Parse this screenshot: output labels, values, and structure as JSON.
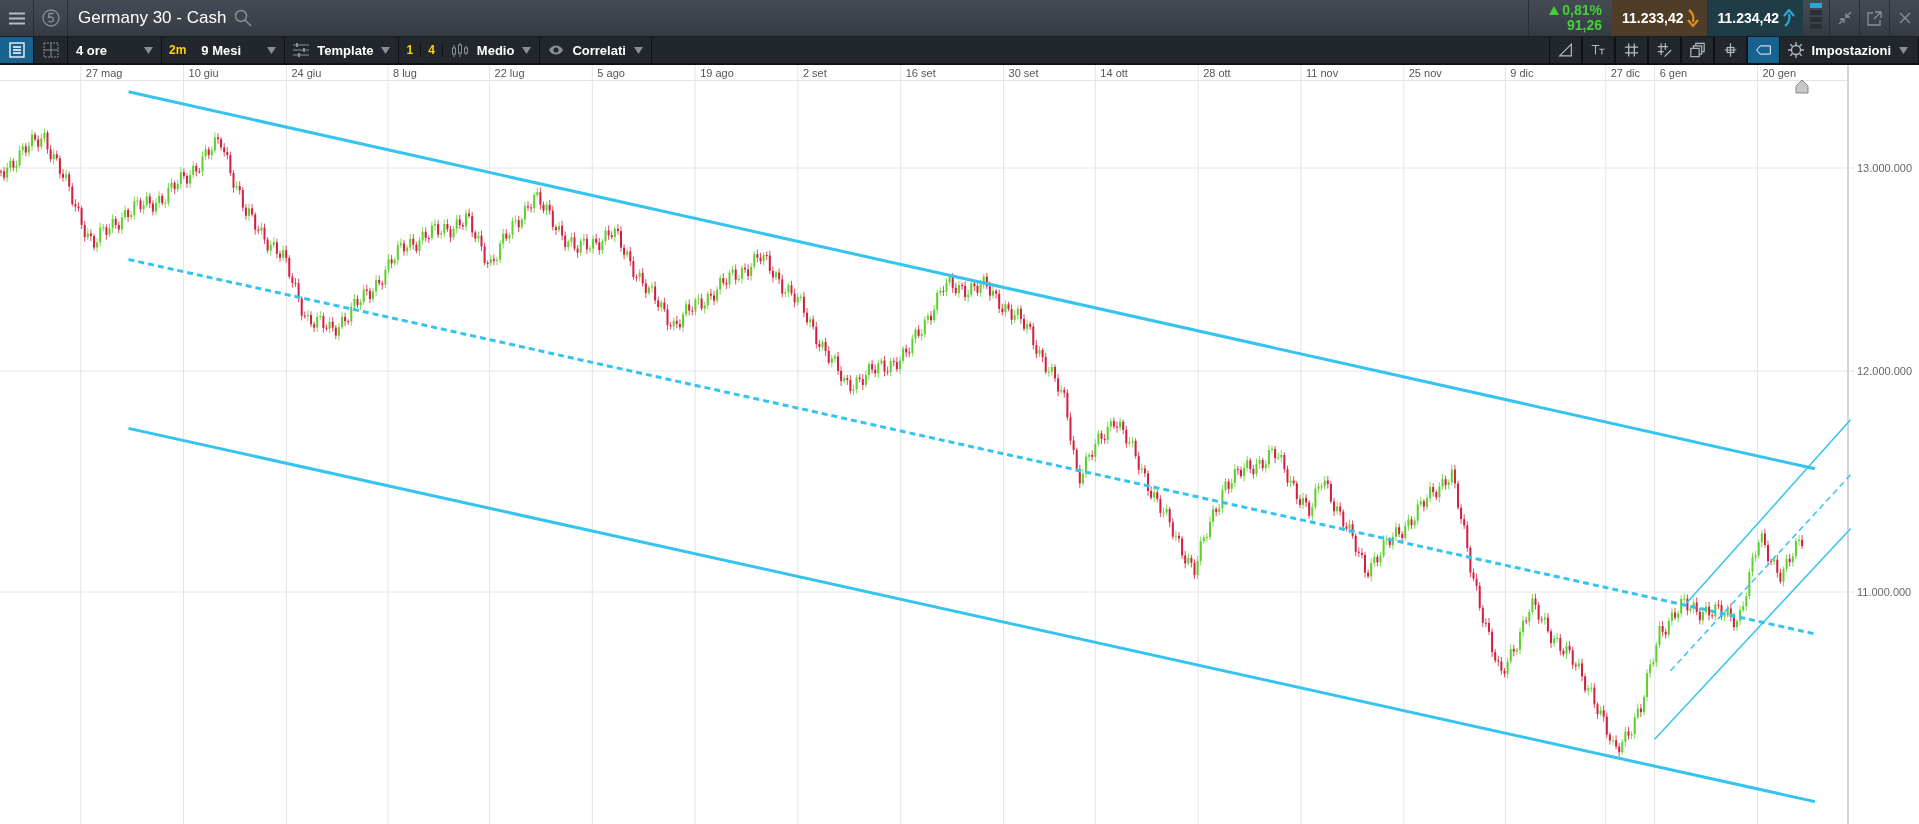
{
  "header": {
    "title": "Germany 30 - Cash",
    "change_percent": "0,81%",
    "change_points": "91,26",
    "sell_price": "11.233,42",
    "buy_price": "11.234,42"
  },
  "toolbar": {
    "views": [
      {
        "kind": "list",
        "selected": true
      },
      {
        "kind": "layout",
        "selected": false
      }
    ],
    "timeframe": "4 ore",
    "timeframe_badge": "2m",
    "range": "9 Mesi",
    "template": "Template",
    "indicator_counts": [
      "1",
      "4"
    ],
    "chart_type": "Medio",
    "related": "Correlati",
    "tools": [
      {
        "kind": "trendline",
        "selected": false
      },
      {
        "kind": "text",
        "selected": false
      },
      {
        "kind": "grid",
        "selected": false
      },
      {
        "kind": "grid-edit",
        "selected": false
      },
      {
        "kind": "layers",
        "selected": false
      },
      {
        "kind": "crosshair",
        "selected": false
      },
      {
        "kind": "tag",
        "selected": true
      }
    ],
    "settings": "Impostazioni"
  },
  "chart": {
    "x_labels": [
      "27 mag",
      "10 giu",
      "24 giu",
      "8 lug",
      "22 lug",
      "5 ago",
      "19 ago",
      "2 set",
      "16 set",
      "30 set",
      "14 ott",
      "28 ott",
      "11 nov",
      "25 nov",
      "9 dic",
      "27 dic",
      "6 gen",
      "20 gen"
    ],
    "y_labels": [
      "13.000.000",
      "12.000.000",
      "11.000.000"
    ]
  }
}
